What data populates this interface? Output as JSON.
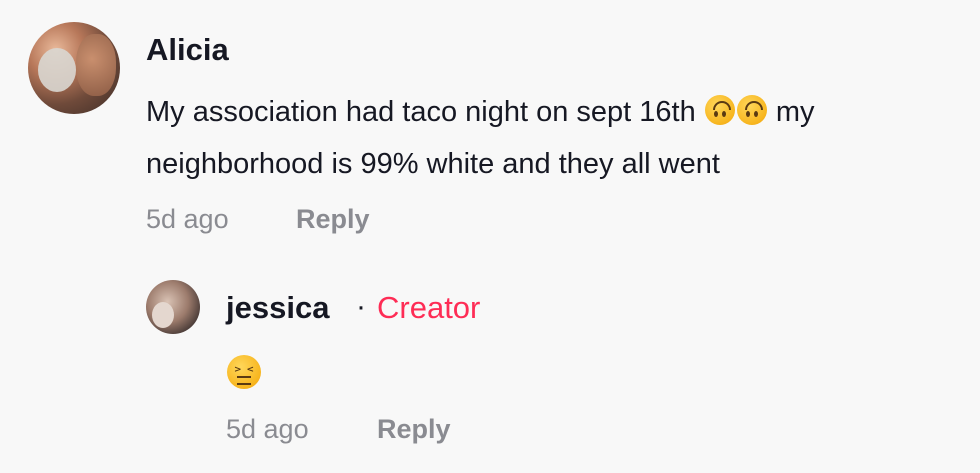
{
  "comment": {
    "username": "Alicia",
    "text_before_emoji": "My association had taco night on sept 16th ",
    "emojis": [
      "upside-down-face-emoji",
      "upside-down-face-emoji"
    ],
    "text_after_emoji": " my neighborhood is 99% white and they all went",
    "time": "5d ago",
    "reply_label": "Reply"
  },
  "reply": {
    "username": "jessica",
    "separator": "·",
    "badge": "Creator",
    "emoji": "confounded-face-emoji",
    "time": "5d ago",
    "reply_label": "Reply"
  },
  "colors": {
    "background": "#f8f8f8",
    "text": "#161823",
    "muted": "#8a8b91",
    "creator": "#fe2c55"
  }
}
